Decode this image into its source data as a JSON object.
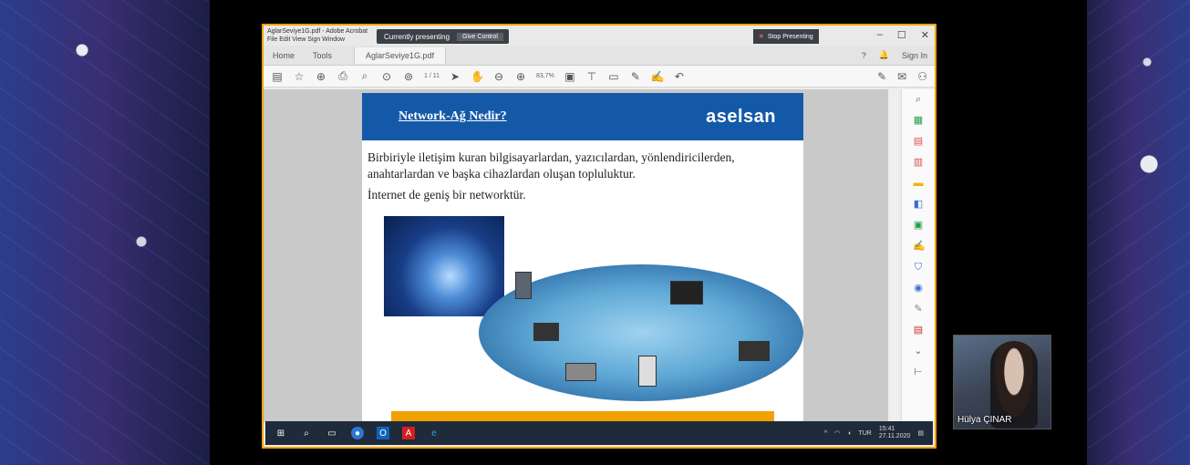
{
  "window": {
    "app_title": "AglarSeviye1G.pdf - Adobe Acrobat",
    "menu": "File  Edit  View  Sign  Window",
    "presenting_label": "Currently presenting",
    "give_control": "Give Control",
    "stop_presenting": "Stop Presenting",
    "controls": [
      "–",
      "☐",
      "✕"
    ]
  },
  "tabs": {
    "home": "Home",
    "tools": "Tools",
    "file": "AglarSeviye1G.pdf",
    "help": "?",
    "bell": "🔔",
    "sign_in": "Sign In"
  },
  "toolbar": {
    "page": "1 / 11",
    "zoom": "83,7%"
  },
  "slide": {
    "title": "Network-Ağ Nedir?",
    "brand": "aselsan",
    "paragraph1": "Birbiriyle iletişim kuran bilgisayarlardan, yazıcılardan, yönlendiricilerden, anahtarlardan ve başka cihazlardan oluşan topluluktur.",
    "paragraph2": "İnternet de geniş bir networktür."
  },
  "taskbar": {
    "time": "15:41",
    "date": "27.11.2020",
    "lang": "TUR"
  },
  "participant": {
    "name": "Hülya ÇINAR"
  }
}
